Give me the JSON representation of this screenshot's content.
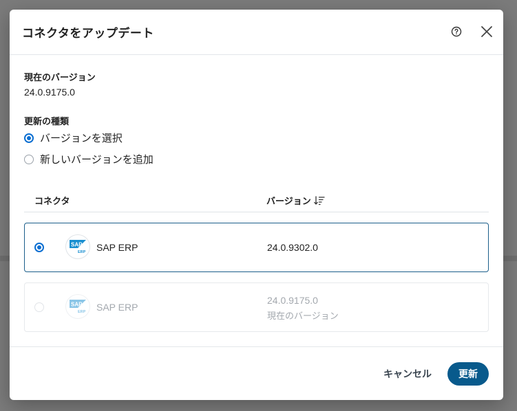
{
  "dialog": {
    "title": "コネクタをアップデート",
    "help_icon": "help-circle-icon",
    "close_icon": "close-icon"
  },
  "current_version": {
    "label": "現在のバージョン",
    "value": "24.0.9175.0"
  },
  "update_type": {
    "label": "更新の種類",
    "options": [
      {
        "label": "バージョンを選択",
        "selected": true
      },
      {
        "label": "新しいバージョンを追加",
        "selected": false
      }
    ]
  },
  "table": {
    "columns": {
      "connector": "コネクタ",
      "version": "バージョン"
    },
    "sort_icon": "sort-descending-icon",
    "rows": [
      {
        "name": "SAP ERP",
        "version": "24.0.9302.0",
        "sub": "",
        "selected": true,
        "disabled": false,
        "logo": "sap-erp-logo"
      },
      {
        "name": "SAP ERP",
        "version": "24.0.9175.0",
        "sub": "現在のバージョン",
        "selected": false,
        "disabled": true,
        "logo": "sap-erp-logo"
      }
    ]
  },
  "footer": {
    "cancel_label": "キャンセル",
    "update_label": "更新"
  },
  "colors": {
    "accent": "#0a6ed1",
    "primary_button": "#085a8c",
    "selected_border": "#1b5e8a",
    "overlay": "#7b7b7b"
  }
}
